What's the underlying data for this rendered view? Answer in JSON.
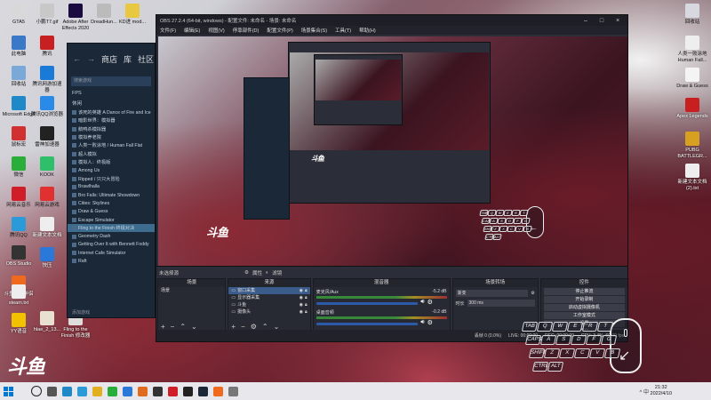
{
  "desktop": {
    "icons": [
      {
        "label": "GTA5",
        "color": "#d8d8d8",
        "light": false,
        "pos": "a"
      },
      {
        "label": "此电脑",
        "color": "#3a78c8",
        "light": false,
        "pos": "b"
      },
      {
        "label": "回收站",
        "color": "#7aa8d8",
        "light": false,
        "pos": "c"
      },
      {
        "label": "Microsoft Edge",
        "color": "#1e88c8",
        "light": false,
        "pos": "d"
      },
      {
        "label": "鼠标宏",
        "color": "#d03030",
        "light": false,
        "pos": "e"
      },
      {
        "label": "微信",
        "color": "#2aae3a",
        "light": false,
        "pos": "f"
      },
      {
        "label": "网易云音乐",
        "color": "#d01e28",
        "light": false,
        "pos": "g"
      },
      {
        "label": "腾讯QQ",
        "color": "#2a9ad8",
        "light": false,
        "pos": "h"
      },
      {
        "label": "OBS Studio",
        "color": "#333",
        "light": true,
        "pos": "i"
      },
      {
        "label": "斗鱼直播伴侣",
        "color": "#f06a1e",
        "light": true,
        "pos": "j"
      },
      {
        "label": "steam.txt",
        "color": "#eee",
        "light": true,
        "pos": "k"
      },
      {
        "label": "YY语音",
        "color": "#f2c200",
        "light": true,
        "pos": "l"
      },
      {
        "label": "小鹏T7.gif",
        "color": "#c8c8c8",
        "light": false,
        "pos": "m"
      },
      {
        "label": "腾讯",
        "color": "#c82020",
        "light": false,
        "pos": "n"
      },
      {
        "label": "腾讯网游加速器",
        "color": "#1a7ad8",
        "light": false,
        "pos": "o"
      },
      {
        "label": "腾讯QQ浏览器",
        "color": "#2a8ae8",
        "light": false,
        "pos": "p"
      },
      {
        "label": "雷神加速器",
        "color": "#222",
        "light": false,
        "pos": "q"
      },
      {
        "label": "KOOK",
        "color": "#2fbf6a",
        "light": false,
        "pos": "r"
      },
      {
        "label": "网易云游戏",
        "color": "#e03030",
        "light": false,
        "pos": "s"
      },
      {
        "label": "新建文本文档",
        "color": "#eee",
        "light": true,
        "pos": "t"
      },
      {
        "label": "快压",
        "color": "#2a78d8",
        "light": true,
        "pos": "u"
      },
      {
        "label": "hlae_2_13...",
        "color": "#e8e0d0",
        "light": true,
        "pos": "v"
      },
      {
        "label": "Adobe After Effects 2020",
        "color": "#1a0a40",
        "light": false,
        "pos": "w"
      },
      {
        "label": "DreadHun...",
        "color": "#bbb",
        "light": false,
        "pos": "x"
      },
      {
        "label": "KD进 mod...",
        "color": "#e8c840",
        "light": false,
        "pos": "y"
      },
      {
        "label": "Fling to the Finish 修改器",
        "color": "#ddd",
        "light": true,
        "pos": "z"
      },
      {
        "label": "回收站",
        "color": "#d8d8e0",
        "light": false,
        "pos": "r1"
      },
      {
        "label": "人类一败涂地 Human Fall...",
        "color": "#eee",
        "light": false,
        "pos": "r2"
      },
      {
        "label": "Draw & Guess",
        "color": "#f4f4f4",
        "light": false,
        "pos": "r3"
      },
      {
        "label": "Apex Legends",
        "color": "#c82020",
        "light": true,
        "pos": "r4"
      },
      {
        "label": "PUBG BATTLEGR...",
        "color": "#d8a020",
        "light": true,
        "pos": "r5"
      },
      {
        "label": "新建文本文档 (2).txt",
        "color": "#eee",
        "light": true,
        "pos": "r6"
      }
    ]
  },
  "obs": {
    "title": "OBS 27.2.4 (64-bit, windows) - 配置文件: 未命名 - 场景: 未命名",
    "menu": [
      "文件(F)",
      "编辑(E)",
      "视图(V)",
      "停靠部件(D)",
      "配置文件(P)",
      "场景集合(S)",
      "工具(T)",
      "帮助(H)"
    ],
    "scene_bar": {
      "label": "未选择源",
      "props": "属性",
      "filters": "滤镜"
    },
    "docks": {
      "scenes": {
        "title": "场景",
        "items": [
          "场景"
        ]
      },
      "sources": {
        "title": "来源",
        "items": [
          "窗口采集",
          "显示器采集",
          "斗鱼",
          "摄像头"
        ]
      },
      "mixer": {
        "title": "混音器",
        "channels": [
          {
            "name": "麦克风/Aux",
            "db": "-5.2 dB"
          },
          {
            "name": "桌面音频",
            "db": "-0.2 dB"
          }
        ]
      },
      "transitions": {
        "title": "场景转场",
        "type": "渐变",
        "duration_label": "时长",
        "duration": "300 ms"
      },
      "controls": {
        "title": "控件",
        "buttons": [
          "停止推流",
          "开始录制",
          "启动虚拟摄像机",
          "工作室模式",
          "设置",
          "退出"
        ]
      }
    },
    "status": {
      "dropped": "丢帧 0 (0.0%)",
      "live": "LIVE: 00:00:00",
      "rec": "REC: 00:00:00",
      "cpu": "CPU: 3.4%, 60.00 fps"
    }
  },
  "steam": {
    "nav": [
      "商店",
      "库",
      "社区"
    ],
    "search_placeholder": "搜索游戏",
    "categories": [
      "FPS",
      "休闲"
    ],
    "games": [
      "该死的英雄 A Dance of Fire and Ice",
      "暗影世界：模拟器",
      "鹅鸭杀模拟器",
      "模拟养老院",
      "人类一败涂地 / Human Fall Flat",
      "超人模拟",
      "模拟人：终极版",
      "Among Us",
      "Ripped / 只只大冒险",
      "Brawlhalla",
      "Bro Falls: Ultimate Showdown",
      "Cities: Skylines",
      "Draw & Guess",
      "Escape Simulator",
      "Fling to the Finish 终极对决",
      "Geometry Dash",
      "Getting Over It with Bennett Foddy",
      "Internet Cafe Simulator",
      "Raft"
    ],
    "selected_game_index": 14,
    "footer": "添加游戏"
  },
  "overlay": {
    "logo_text": "斗鱼",
    "keyboard_keys": [
      [
        "TAB",
        "Q",
        "W",
        "E",
        "R",
        "T"
      ],
      [
        "CAPS",
        "A",
        "S",
        "D",
        "F",
        "G"
      ],
      [
        "SHIFT",
        "Z",
        "X",
        "C",
        "V",
        "B"
      ],
      [
        "CTRL",
        "ALT"
      ]
    ]
  },
  "taskbar": {
    "clock_time": "21:32",
    "clock_date": "2022/4/10",
    "tray": "^ 中"
  },
  "colors": {
    "obs_bg": "#2b2e38",
    "steam_bg": "#1b2838",
    "accent": "#3b5b8a"
  }
}
